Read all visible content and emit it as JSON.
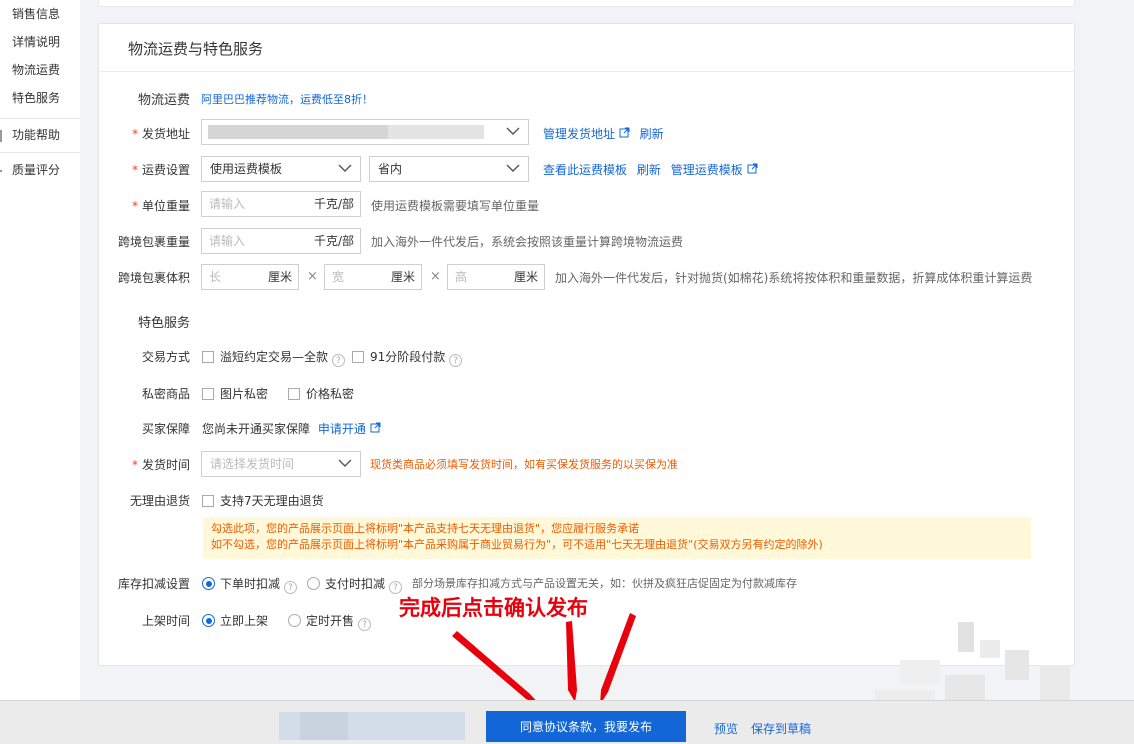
{
  "sidebar": {
    "items": [
      "销售信息",
      "详情说明",
      "物流运费",
      "特色服务"
    ],
    "groups": [
      "功能帮助",
      "质量评分"
    ]
  },
  "section": {
    "title": "物流运费与特色服务"
  },
  "logistics": {
    "heading": "物流运费",
    "promo_link": "阿里巴巴推荐物流，运费低至8折！",
    "ship_address": {
      "label": "发货地址",
      "required_mark": "*",
      "manage_link": "管理发货地址",
      "refresh_link": "刷新"
    },
    "freight": {
      "label": "运费设置",
      "required_mark": "*",
      "template_select": "使用运费模板",
      "region_select": "省内",
      "view_link": "查看此运费模板",
      "refresh_link": "刷新",
      "manage_link": "管理运费模板"
    },
    "unit_weight": {
      "label": "单位重量",
      "required_mark": "*",
      "placeholder": "请输入",
      "unit": "千克/部",
      "hint": "使用运费模板需要填写单位重量"
    },
    "cross_weight": {
      "label": "跨境包裹重量",
      "placeholder": "请输入",
      "unit": "千克/部",
      "hint": "加入海外一件代发后，系统会按照该重量计算跨境物流运费"
    },
    "cross_volume": {
      "label": "跨境包裹体积",
      "fields": [
        {
          "placeholder": "长",
          "unit": "厘米"
        },
        {
          "placeholder": "宽",
          "unit": "厘米"
        },
        {
          "placeholder": "高",
          "unit": "厘米"
        }
      ],
      "times": "×",
      "hint": "加入海外一件代发后，针对抛货(如棉花)系统将按体积和重量数据，折算成体积重计算运费"
    }
  },
  "special": {
    "heading": "特色服务",
    "trade": {
      "label": "交易方式",
      "opt1": "溢短约定交易—全款",
      "opt2": "91分阶段付款"
    },
    "private": {
      "label": "私密商品",
      "opt1": "图片私密",
      "opt2": "价格私密"
    },
    "buyer_protect": {
      "label": "买家保障",
      "text": "您尚未开通买家保障",
      "link": "申请开通"
    },
    "ship_time": {
      "label": "发货时间",
      "required_mark": "*",
      "placeholder": "请选择发货时间",
      "warning": "现货类商品必须填写发货时间，如有买保发货服务的以买保为准"
    },
    "return": {
      "label": "无理由退货",
      "opt": "支持7天无理由退货",
      "notice_line1": "勾选此项，您的产品展示页面上将标明\"本产品支持七天无理由退货\"，您应履行服务承诺",
      "notice_line2": "如不勾选，您的产品展示页面上将标明\"本产品采购属于商业贸易行为\"，可不适用\"七天无理由退货\"(交易双方另有约定的除外)"
    },
    "inventory": {
      "label": "库存扣减设置",
      "opt1": "下单时扣减",
      "opt2": "支付时扣减",
      "hint": "部分场景库存扣减方式与产品设置无关，如：伙拼及疯狂店促固定为付款减库存"
    },
    "listing": {
      "label": "上架时间",
      "opt1": "立即上架",
      "opt2": "定时开售"
    }
  },
  "annotation": "完成后点击确认发布",
  "footer": {
    "publish": "同意协议条款，我要发布",
    "preview": "预览",
    "save_draft": "保存到草稿"
  },
  "colors": {
    "accent": "#1366d6",
    "link": "#1367d8",
    "warning": "#f05a00",
    "annotation": "#e8000c"
  }
}
